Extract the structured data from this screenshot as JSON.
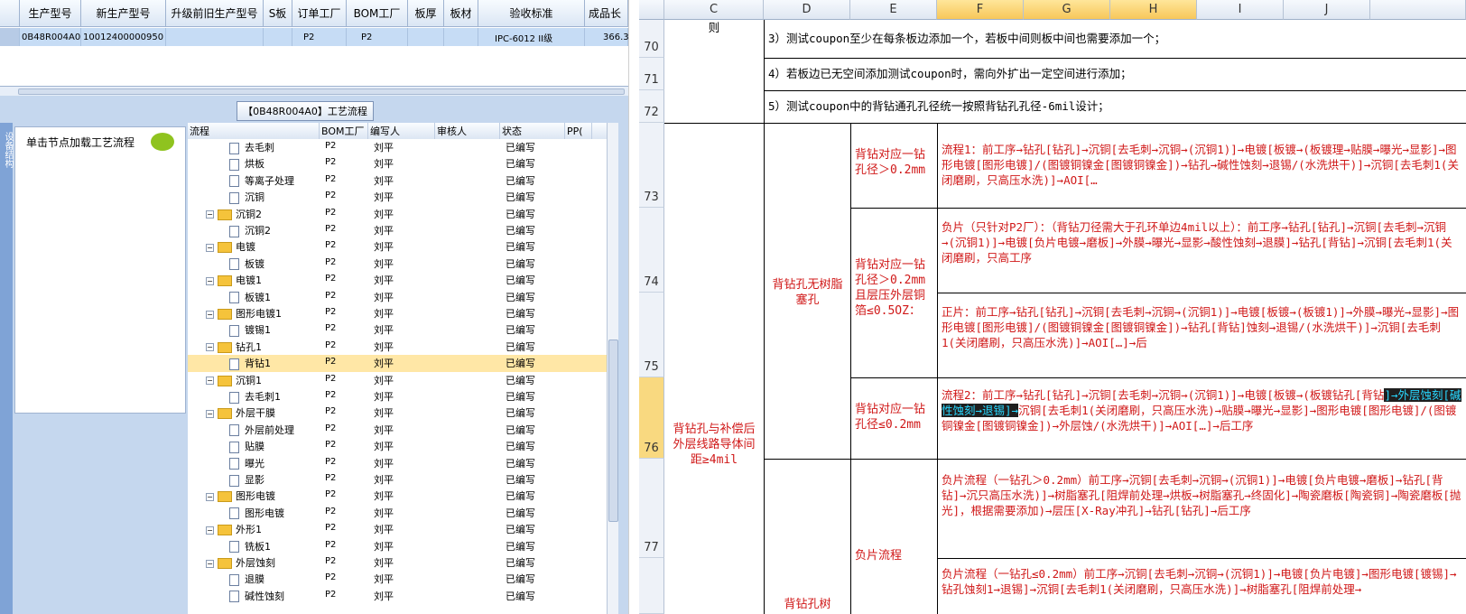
{
  "top_grid": {
    "headers": [
      "生产型号",
      "新生产型号",
      "升级前旧生产型号",
      "S板",
      "订单工厂",
      "BOM工厂",
      "板厚",
      "板材",
      "验收标准",
      "成品长"
    ],
    "row": [
      "0B48R004A0",
      "10012400000950",
      "",
      "",
      "P2",
      "P2",
      "",
      "",
      "IPC-6012 II级",
      "366.300"
    ]
  },
  "panel_title": "【0B48R004A0】工艺流程",
  "sidebar_label": "设备结构",
  "node_hint": "单击节点加载工艺流程",
  "tree": {
    "headers": [
      "流程",
      "BOM工厂",
      "编写人",
      "审核人",
      "状态",
      "PP("
    ],
    "rows": [
      {
        "name": "去毛刺",
        "type": "leaf",
        "bom": "P2",
        "author": "刘平",
        "status": "已编写"
      },
      {
        "name": "烘板",
        "type": "leaf",
        "bom": "P2",
        "author": "刘平",
        "status": "已编写"
      },
      {
        "name": "等离子处理",
        "type": "leaf",
        "bom": "P2",
        "author": "刘平",
        "status": "已编写"
      },
      {
        "name": "沉铜",
        "type": "leaf",
        "bom": "P2",
        "author": "刘平",
        "status": "已编写"
      },
      {
        "name": "沉铜2",
        "type": "folder",
        "bom": "P2",
        "author": "刘平",
        "status": "已编写"
      },
      {
        "name": "沉铜2",
        "type": "leaf",
        "bom": "P2",
        "author": "刘平",
        "status": "已编写"
      },
      {
        "name": "电镀",
        "type": "folder",
        "bom": "P2",
        "author": "刘平",
        "status": "已编写"
      },
      {
        "name": "板镀",
        "type": "leaf",
        "bom": "P2",
        "author": "刘平",
        "status": "已编写"
      },
      {
        "name": "电镀1",
        "type": "folder",
        "bom": "P2",
        "author": "刘平",
        "status": "已编写"
      },
      {
        "name": "板镀1",
        "type": "leaf",
        "bom": "P2",
        "author": "刘平",
        "status": "已编写"
      },
      {
        "name": "图形电镀1",
        "type": "folder",
        "bom": "P2",
        "author": "刘平",
        "status": "已编写"
      },
      {
        "name": "镀锡1",
        "type": "leaf",
        "bom": "P2",
        "author": "刘平",
        "status": "已编写"
      },
      {
        "name": "钻孔1",
        "type": "folder",
        "bom": "P2",
        "author": "刘平",
        "status": "已编写"
      },
      {
        "name": "背钻1",
        "type": "leaf",
        "bom": "P2",
        "author": "刘平",
        "status": "已编写",
        "selected": true
      },
      {
        "name": "沉铜1",
        "type": "folder",
        "bom": "P2",
        "author": "刘平",
        "status": "已编写"
      },
      {
        "name": "去毛刺1",
        "type": "leaf",
        "bom": "P2",
        "author": "刘平",
        "status": "已编写"
      },
      {
        "name": "外层干膜",
        "type": "folder",
        "bom": "P2",
        "author": "刘平",
        "status": "已编写"
      },
      {
        "name": "外层前处理",
        "type": "leaf",
        "bom": "P2",
        "author": "刘平",
        "status": "已编写"
      },
      {
        "name": "贴膜",
        "type": "leaf",
        "bom": "P2",
        "author": "刘平",
        "status": "已编写"
      },
      {
        "name": "曝光",
        "type": "leaf",
        "bom": "P2",
        "author": "刘平",
        "status": "已编写"
      },
      {
        "name": "显影",
        "type": "leaf",
        "bom": "P2",
        "author": "刘平",
        "status": "已编写"
      },
      {
        "name": "图形电镀",
        "type": "folder",
        "bom": "P2",
        "author": "刘平",
        "status": "已编写"
      },
      {
        "name": "图形电镀",
        "type": "leaf",
        "bom": "P2",
        "author": "刘平",
        "status": "已编写"
      },
      {
        "name": "外形1",
        "type": "folder",
        "bom": "P2",
        "author": "刘平",
        "status": "已编写"
      },
      {
        "name": "铣板1",
        "type": "leaf",
        "bom": "P2",
        "author": "刘平",
        "status": "已编写"
      },
      {
        "name": "外层蚀刻",
        "type": "folder",
        "bom": "P2",
        "author": "刘平",
        "status": "已编写"
      },
      {
        "name": "退膜",
        "type": "leaf",
        "bom": "P2",
        "author": "刘平",
        "status": "已编写"
      },
      {
        "name": "碱性蚀刻",
        "type": "leaf",
        "bom": "P2",
        "author": "刘平",
        "status": "已编写"
      }
    ]
  },
  "sheet": {
    "columns": [
      "C",
      "D",
      "E",
      "F",
      "G",
      "H",
      "I",
      "J"
    ],
    "rows": [
      "70",
      "71",
      "72",
      "73",
      "74",
      "75",
      "76",
      "77"
    ],
    "c70": "则",
    "r70": "3）测试coupon至少在每条板边添加一个，若板中间则板中间也需要添加一个；",
    "r71": "4）若板边已无空间添加测试coupon时，需向外扩出一定空间进行添加；",
    "r72": "5）测试coupon中的背钻通孔孔径统一按照背钻孔孔径-6mil设计；",
    "c_main": "背钻孔与补偿后外层线路导体间距≥4mil",
    "d_main": "背钻孔无树脂塞孔",
    "d_bottom": "背钻孔树",
    "e73": "背钻对应一钻孔径＞0.2mm",
    "e74": "背钻对应一钻孔径＞0.2mm且层压外层铜箔≤0.5OZ：",
    "e76": "背钻对应一钻孔径≤0.2mm",
    "e77": "负片流程",
    "f73": "流程1：前工序→钻孔[钻孔]→沉铜[去毛刺→沉铜→(沉铜1)]→电镀[板镀→(板镀理→贴膜→曝光→显影]→图形电镀[图形电镀]/(图镀铜镍金[图镀铜镍金])→钻孔→碱性蚀刻→退锡/(水洗烘干)]→沉铜[去毛刺1(关闭磨刷，只高压水洗)]→AOI[…",
    "f74": "负片（只针对P2厂）：（背钻刀径需大于孔环单边4mil以上）：前工序→钻孔[钻孔]→沉铜[去毛刺→沉铜→(沉铜1)]→电镀[负片电镀→磨板]→外膜→曝光→显影→酸性蚀刻→退膜]→钻孔[背钻]→沉铜[去毛刺1(关闭磨刷，只高工序",
    "f75": "正片：前工序→钻孔[钻孔]→沉铜[去毛刺→沉铜→(沉铜1)]→电镀[板镀→(板镀1)]→外膜→曝光→显影]→图形电镀[图形电镀]/(图镀铜镍金[图镀铜镍金])→钻孔[背钻]蚀刻→退锡/(水洗烘干)]→沉铜[去毛刺1(关闭磨刷，只高压水洗)]→AOI[…]→后",
    "f76_a": "流程2：前工序→钻孔[钻孔]→沉铜[去毛刺→沉铜→(沉铜1)]→电镀[板镀→(板镀钻孔[背钻",
    "f76_hi": "]→外层蚀刻[碱性蚀刻→退锡]→",
    "f76_b": "沉铜[去毛刺1(关闭磨刷，只高压水洗)→贴膜→曝光→显影]→图形电镀[图形电镀]/(图镀铜镍金[图镀铜镍金])→外层蚀/(水洗烘干)]→AOI[…]→后工序",
    "f77": "负片流程（一钻孔＞0.2mm）前工序→沉铜[去毛刺→沉铜→(沉铜1)]→电镀[负片电镀→磨板]→钻孔[背钻]→沉只高压水洗)]→树脂塞孔[阻焊前处理→烘板→树脂塞孔→终固化]→陶瓷磨板[陶瓷铜]→陶瓷磨板[抛光]，根据需要添加)→层压[X-Ray冲孔]→钻孔[钻孔]→后工序",
    "f78": "负片流程（一钻孔≤0.2mm）前工序→沉铜[去毛刺→沉铜→(沉铜1)]→电镀[负片电镀]→图形电镀[镀锡]→钻孔蚀刻1→退锡]→沉铜[去毛刺1(关闭磨刷，只高压水洗)]→树脂塞孔[阻焊前处理→"
  }
}
